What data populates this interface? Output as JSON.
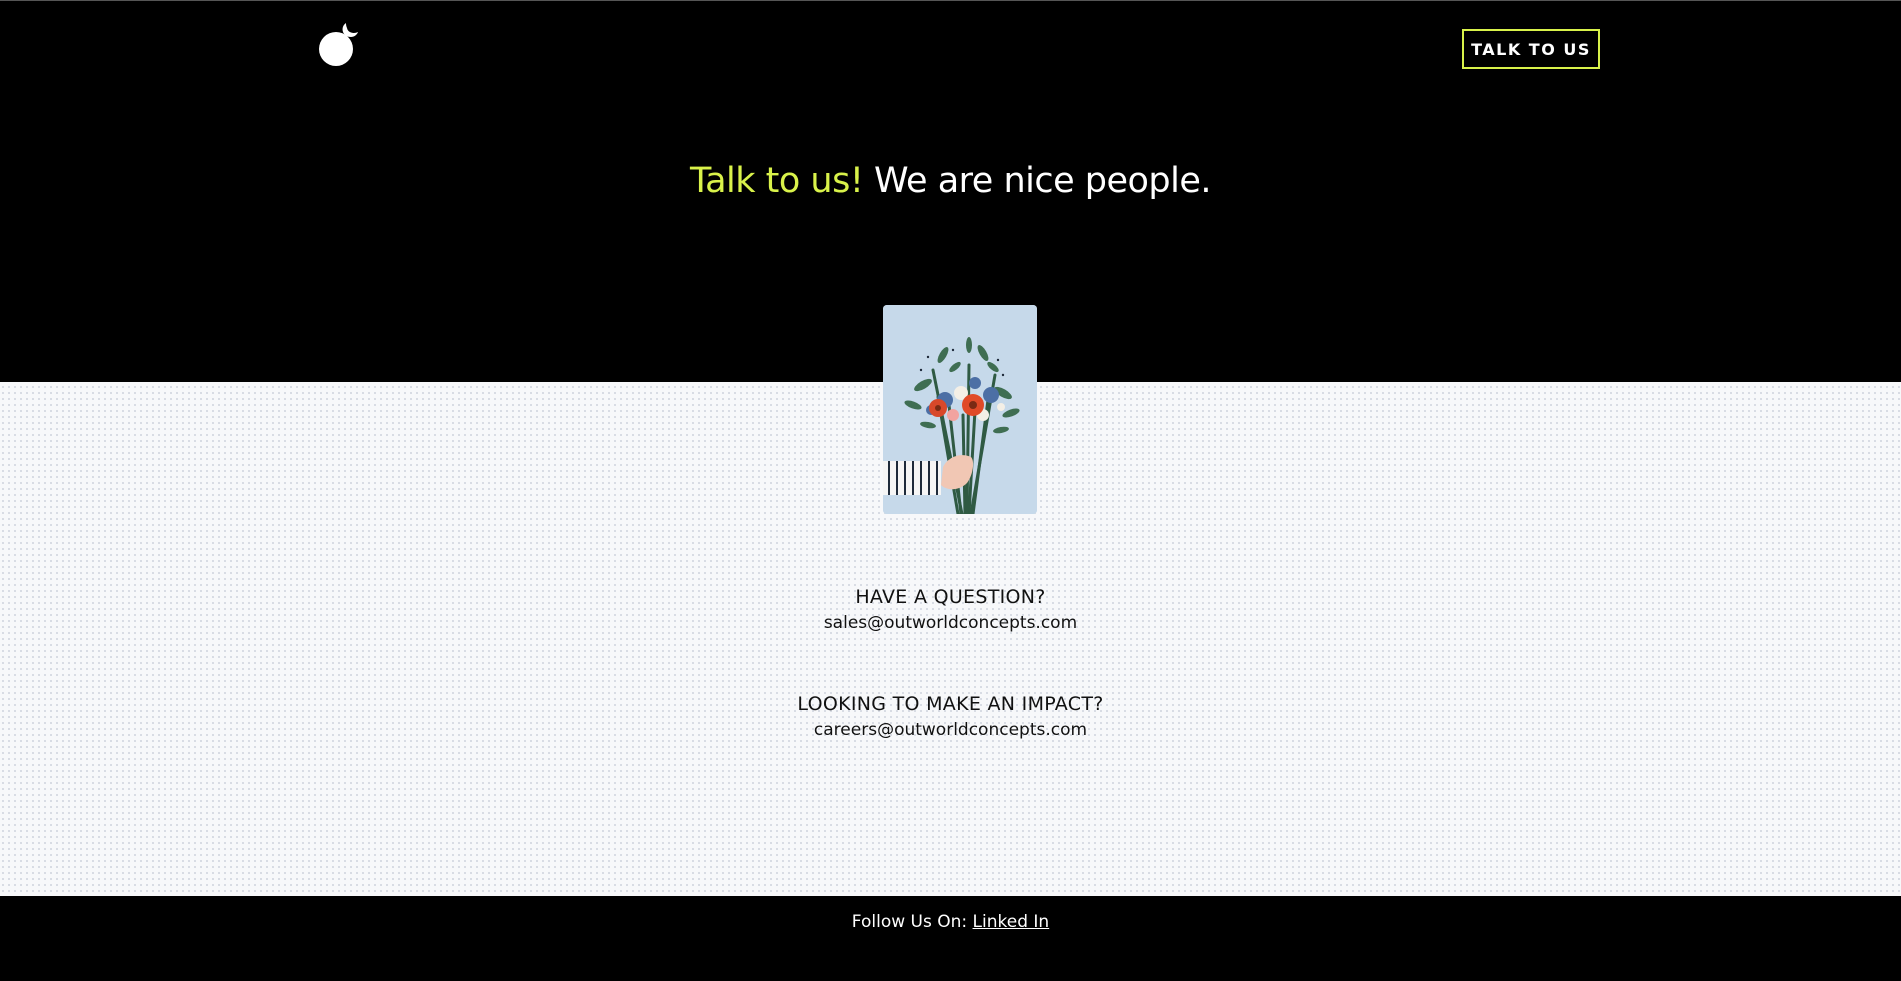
{
  "header": {
    "cta_label": "TALK TO US"
  },
  "hero": {
    "headline_accent": "Talk to us!",
    "headline_rest": "We are nice people."
  },
  "contacts": [
    {
      "question": "HAVE A QUESTION?",
      "email": "sales@outworldconcepts.com"
    },
    {
      "question": "LOOKING TO MAKE AN IMPACT?",
      "email": "careers@outworldconcepts.com"
    }
  ],
  "footer": {
    "follow_label": "Follow Us On:",
    "link_label": "Linked In"
  },
  "colors": {
    "accent": "#d9f24a",
    "dark": "#000000",
    "light_bg": "#f7f8fa"
  },
  "icons": {
    "logo": "outworld-logo-icon"
  }
}
